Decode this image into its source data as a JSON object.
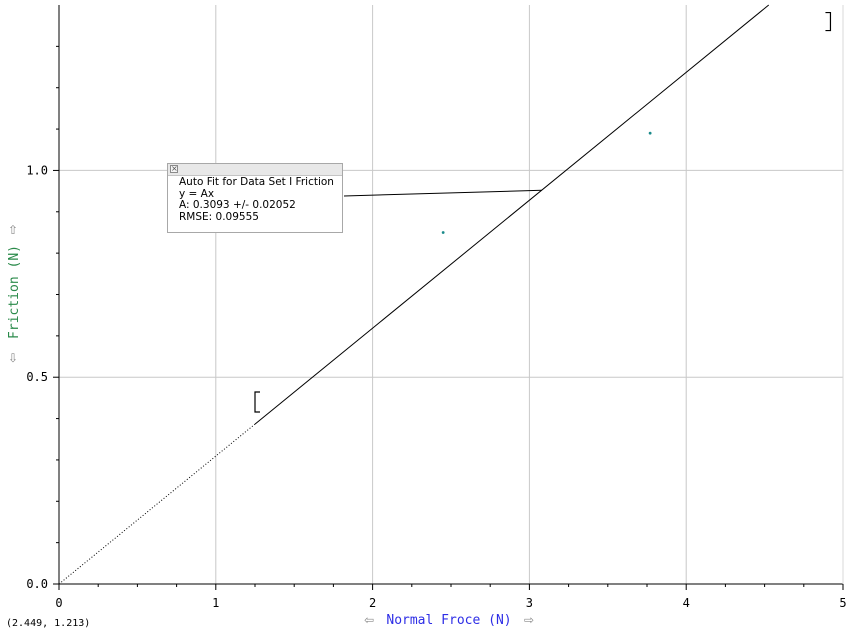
{
  "chart_data": {
    "type": "scatter",
    "xlabel": "Normal Froce (N)",
    "ylabel": "Friction (N)",
    "xlim": [
      0,
      5
    ],
    "ylim": [
      0,
      1.4
    ],
    "x_ticks": [
      "0",
      "1",
      "2",
      "3",
      "4",
      "5"
    ],
    "y_ticks": [
      "0.0",
      "0.5",
      "1.0"
    ],
    "grid": true,
    "series": [
      {
        "points": [
          [
            2.45,
            0.85
          ],
          [
            3.77,
            1.09
          ]
        ],
        "color": "#1a8a8a"
      }
    ],
    "fit": {
      "model": "y = Ax",
      "A": 0.3093,
      "fit_range_x": [
        1.25,
        5.0
      ],
      "color": "#000000"
    },
    "range_brackets": {
      "left_x": 1.25,
      "left_y": 0.44,
      "right_x": 4.92,
      "right_y": 1.36
    }
  },
  "fit_box": {
    "close_icon": "close-icon",
    "line1": "Auto Fit for  Data Set I Friction",
    "line2": "y = Ax",
    "line3": "A: 0.3093 +/- 0.02052",
    "line4": "RMSE: 0.09555",
    "anchor_point": [
      3.08,
      0.952
    ]
  },
  "coord_readout": "(2.449, 1.213)",
  "icons": {
    "x_scroll_left": "⇦",
    "x_scroll_right": "⇨",
    "y_scroll_up": "⇧",
    "y_scroll_down": "⇩"
  },
  "colors": {
    "grid": "#c8c8c8",
    "frame": "#000000",
    "x_title": "#2e2ee6",
    "y_title": "#2a8a4a"
  }
}
